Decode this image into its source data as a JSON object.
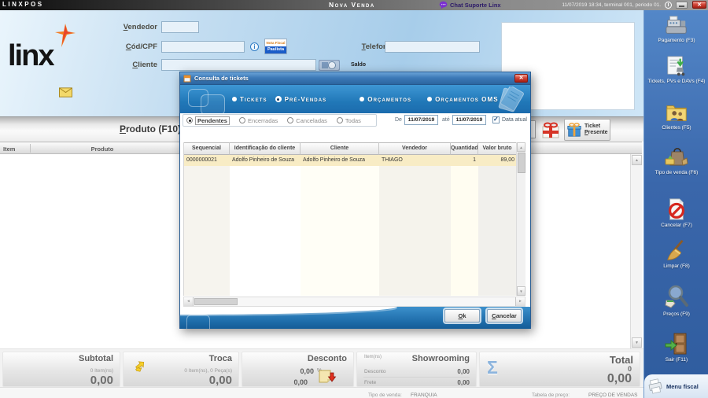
{
  "titlebar": {
    "app": "LINXPOS",
    "screen": "Nova Venda",
    "chat": "Chat Suporte Linx",
    "session": "11/07/2019 18:34, terminal 001, periodo 01."
  },
  "form": {
    "brand": "linx",
    "vendedor_label": "Vendedor",
    "cod_cpf_label": "Cód/CPF",
    "cliente_label": "Cliente",
    "telefone_label": "Telefone",
    "saldo_label": "Saldo",
    "nfp_top": "Nota Fiscal",
    "nfp_bottom": "Paulista"
  },
  "produto_row": {
    "label": "Produto (F10)",
    "ticket_line1": "Ticket",
    "ticket_line2": "Presente"
  },
  "grid": {
    "item_header": "Item",
    "produto_header": "Produto"
  },
  "modal": {
    "title": "Consulta de tickets",
    "tabs": [
      {
        "label": "Tickets",
        "selected": false
      },
      {
        "label": "Pré-Vendas",
        "selected": true
      },
      {
        "label": "Orçamentos",
        "selected": false
      },
      {
        "label": "Orçamentos OMS",
        "selected": false
      }
    ],
    "filters": [
      {
        "label": "Pendentes",
        "selected": true
      },
      {
        "label": "Encerradas",
        "selected": false
      },
      {
        "label": "Canceladas",
        "selected": false
      },
      {
        "label": "Todas",
        "selected": false
      }
    ],
    "de_label": "De",
    "ate_label": "até",
    "date_from": "11/07/2019",
    "date_to": "11/07/2019",
    "data_atual_label": "Data atual",
    "data_atual_checked": true,
    "table": {
      "columns": [
        "Sequencial",
        "Identificação do cliente",
        "Cliente",
        "Vendedor",
        "Quantidade",
        "Valor bruto"
      ],
      "rows": [
        [
          "0000000021",
          "Adolfo Pinheiro de Souza",
          "Adolfo Pinheiro de Souza",
          "THIAGO",
          "1",
          "89,00"
        ]
      ]
    },
    "ok_label": "Ok",
    "cancel_label": "Cancelar"
  },
  "totals": {
    "subtotal": {
      "title": "Subtotal",
      "items": "0 Item(ns)",
      "value": "0,00"
    },
    "troca": {
      "title": "Troca",
      "items": "0 Item(ns), 0 Peça(s)",
      "value": "0,00"
    },
    "desconto": {
      "title": "Desconto",
      "percent_value": "0,00",
      "percent_suffix": "%",
      "value": "0,00"
    },
    "showrooming": {
      "title": "Showrooming",
      "items_label": "Item(ns)",
      "desconto_label": "Desconto",
      "desconto_value": "0,00",
      "frete_label": "Frete",
      "frete_value": "0,00"
    },
    "total": {
      "title": "Total",
      "sigma_icon": "Σ",
      "count": "0",
      "value": "0,00"
    }
  },
  "statusbar": {
    "tipo_venda_label": "Tipo de venda:",
    "tipo_venda_value": "FRANQUIA",
    "tabela_label": "Tabela de preço:",
    "tabela_value": "PREÇO DE VENDAS"
  },
  "sidebar": {
    "items": [
      {
        "label": "Pagamento (F3)"
      },
      {
        "label": "Tickets, PVs e DAVs (F4)"
      },
      {
        "label": "Clientes (F5)"
      },
      {
        "label": "Tipo de venda (F6)"
      },
      {
        "label": "Cancelar (F7)"
      },
      {
        "label": "Limpar (F8)"
      },
      {
        "label": "Preços (F9)"
      },
      {
        "label": "Sair (F11)"
      }
    ],
    "menu_fiscal_label": "Menu fiscal"
  }
}
